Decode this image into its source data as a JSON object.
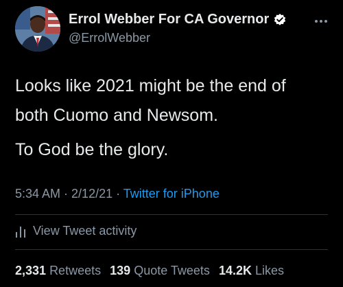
{
  "author": {
    "display_name": "Errol Webber For CA Governor",
    "handle": "@ErrolWebber",
    "verified": true
  },
  "tweet": {
    "lines": [
      "Looks like 2021 might be the end of",
      "both Cuomo and Newsom.",
      "To God be the glory."
    ]
  },
  "meta": {
    "time": "5:34 AM",
    "sep1": " · ",
    "date": "2/12/21",
    "sep2": " · ",
    "source": "Twitter for iPhone"
  },
  "activity": {
    "label": "View Tweet activity",
    "icon": "bar-chart-icon"
  },
  "stats": {
    "retweets_count": "2,331",
    "retweets_label": "Retweets",
    "quotes_count": "139",
    "quotes_label": "Quote Tweets",
    "likes_count": "14.2K",
    "likes_label": "Likes"
  },
  "colors": {
    "background": "#000000",
    "text": "#e7e9ea",
    "secondary": "#8b98a5",
    "link": "#1d9bf0",
    "divider": "#2f3336"
  }
}
